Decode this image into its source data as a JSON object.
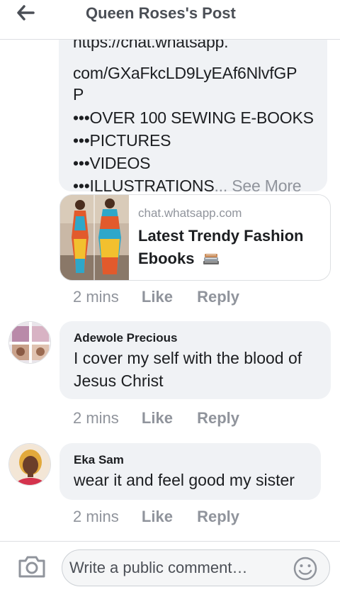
{
  "header": {
    "title": "Queen Roses's Post"
  },
  "post": {
    "lines": [
      "https://chat.whatsapp.",
      "com/GXaFkcLD9LyEAf6NlvfGP",
      "P",
      "•••OVER 100 SEWING E-BOOKS",
      "•••PICTURES",
      "•••VIDEOS",
      "•••ILLUSTRATIONS"
    ],
    "ellipsis": "...",
    "see_more": "See More",
    "link_preview": {
      "domain": "chat.whatsapp.com",
      "title": "Latest Trendy Fashion Ebooks"
    },
    "time": "2 mins",
    "like_label": "Like",
    "reply_label": "Reply"
  },
  "comments": [
    {
      "author": "Adewole Precious",
      "text": "I cover my self with the blood of Jesus Christ",
      "time": "2 mins",
      "like_label": "Like",
      "reply_label": "Reply"
    },
    {
      "author": "Eka Sam",
      "text": "wear it and feel good my sister",
      "time": "2 mins",
      "like_label": "Like",
      "reply_label": "Reply"
    }
  ],
  "composer": {
    "placeholder": "Write a public comment…"
  },
  "icons": {
    "back": "arrow-left-icon",
    "camera": "camera-icon",
    "emoji": "smiley-icon",
    "books": "books-emoji"
  }
}
